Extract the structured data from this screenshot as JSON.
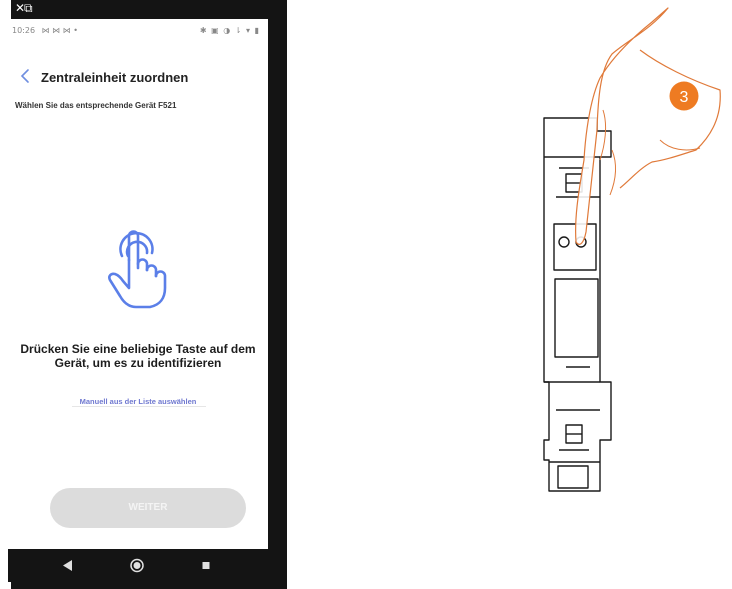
{
  "overlay": {
    "logo_glyph": "✕⧉"
  },
  "status_bar": {
    "time": "10:26",
    "left_icons": "⋈ ⋈ ⋈ •",
    "right_icons": "✱ ▣ ◑ ⇂ ▾ ▮"
  },
  "header": {
    "title": "Zentraleinheit zuordnen",
    "back_icon": "chevron-left-icon"
  },
  "instruction": {
    "text": "Wählen Sie das entsprechende Gerät F521"
  },
  "illustration": {
    "icon": "hand-pointer-press-icon",
    "color": "#5b7fe8"
  },
  "prompt": {
    "text": "Drücken Sie eine beliebige Taste auf dem Gerät, um es zu identifizieren"
  },
  "manual_link": {
    "label": "Manuell aus der Liste auswählen"
  },
  "next_button": {
    "label": "WEITER"
  },
  "nav_bar": {
    "icons": [
      "back-triangle-icon",
      "home-circle-icon",
      "recents-square-icon"
    ]
  },
  "device_illustration": {
    "step_badge": "3",
    "badge_color": "#ee7b22"
  }
}
